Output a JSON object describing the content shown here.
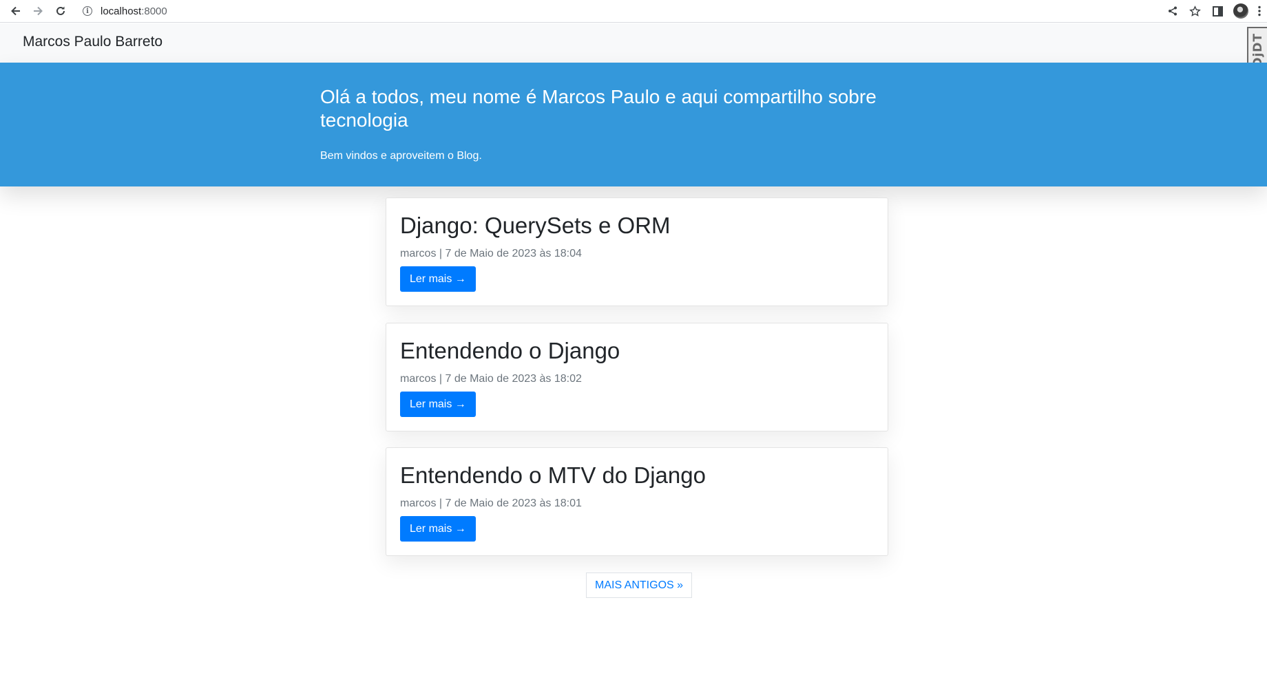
{
  "browser": {
    "url_host": "localhost",
    "url_port": ":8000",
    "back_icon": "arrow-left-icon",
    "forward_icon": "arrow-right-icon",
    "reload_icon": "reload-icon",
    "info_icon": "info-icon",
    "info_glyph": "i",
    "share_icon": "share-icon",
    "bookmark_icon": "star-icon",
    "sidepanel_icon": "side-panel-icon",
    "menu_icon": "kebab-menu-icon"
  },
  "navbar": {
    "brand": "Marcos Paulo Barreto"
  },
  "debug_toolbar": {
    "label": "DjDT"
  },
  "masthead": {
    "heading": "Olá a todos, meu nome é Marcos Paulo e aqui compartilho sobre tecnologia",
    "subheading": "Bem vindos e aproveitem o Blog."
  },
  "posts": [
    {
      "title": "Django: QuerySets e ORM",
      "meta": "marcos | 7 de Maio de 2023 às 18:04",
      "button": "Ler mais →"
    },
    {
      "title": "Entendendo o Django",
      "meta": "marcos | 7 de Maio de 2023 às 18:02",
      "button": "Ler mais →"
    },
    {
      "title": "Entendendo o MTV do Django",
      "meta": "marcos | 7 de Maio de 2023 às 18:01",
      "button": "Ler mais →"
    }
  ],
  "pagination": {
    "older": "MAIS ANTIGOS »"
  },
  "colors": {
    "masthead": "#3498db",
    "primary_button": "#007bff",
    "navbar_bg": "#f8f9fa"
  }
}
